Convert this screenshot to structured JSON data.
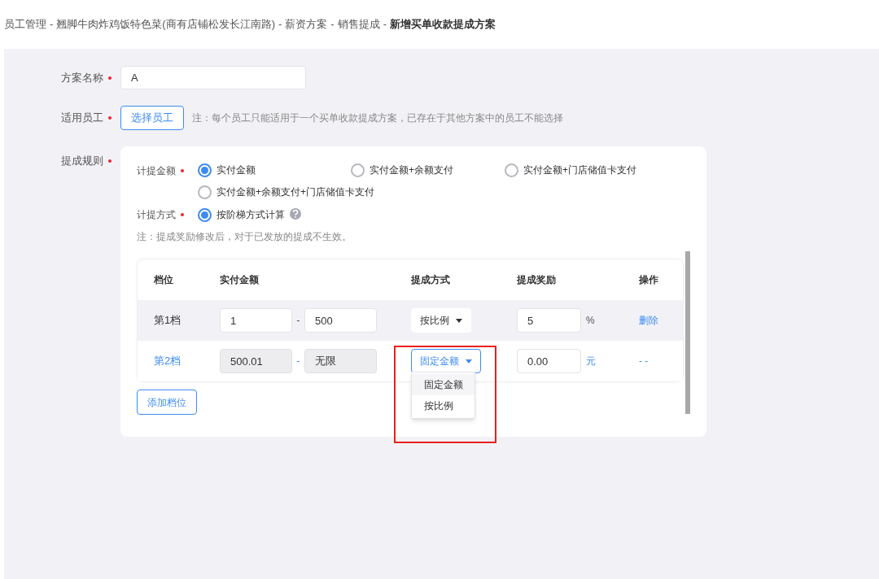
{
  "breadcrumb": {
    "items": [
      "员工管理",
      "翘脚牛肉炸鸡饭特色菜(商有店铺松发长江南路)",
      "薪资方案",
      "销售提成"
    ],
    "separator": "-",
    "current": "新增买单收款提成方案"
  },
  "form": {
    "name_field": {
      "label": "方案名称",
      "required": true,
      "value": "A"
    },
    "staff": {
      "label": "适用员工",
      "required": true,
      "button": "选择员工",
      "note": "注：每个员工只能适用于一个买单收款提成方案，已存在于其他方案中的员工不能选择"
    },
    "rules": {
      "label": "提成规则",
      "required": true,
      "amount": {
        "label": "计提金额",
        "required": true,
        "options": [
          {
            "label": "实付金额",
            "selected": true
          },
          {
            "label": "实付金额+余额支付",
            "selected": false
          },
          {
            "label": "实付金额+门店储值卡支付",
            "selected": false
          },
          {
            "label": "实付金额+余额支付+门店储值卡支付",
            "selected": false
          }
        ]
      },
      "method": {
        "label": "计提方式",
        "required": true,
        "options": [
          {
            "label": "按阶梯方式计算",
            "selected": true
          }
        ]
      },
      "note": "注：提成奖励修改后，对于已发放的提成不生效。",
      "table": {
        "columns": [
          "档位",
          "实付金额",
          "提成方式",
          "提成奖励",
          "操作"
        ],
        "rows": [
          {
            "tier": "第1档",
            "from": "1",
            "to": "500",
            "range_disabled": false,
            "separator": "-",
            "mode": "按比例",
            "reward": "5",
            "unit": "%",
            "action": "删除",
            "hovered": true,
            "selected": false,
            "dropdown_open": false
          },
          {
            "tier": "第2档",
            "from": "500.01",
            "to": "无限",
            "range_disabled": true,
            "separator": "-",
            "mode": "固定金额",
            "reward": "0.00",
            "unit": "元",
            "action": "- -",
            "hovered": false,
            "selected": true,
            "dropdown_open": true,
            "dropdown_options": [
              {
                "label": "固定金额",
                "selected": true
              },
              {
                "label": "按比例",
                "selected": false
              }
            ]
          }
        ]
      },
      "add_button": "添加档位"
    }
  }
}
